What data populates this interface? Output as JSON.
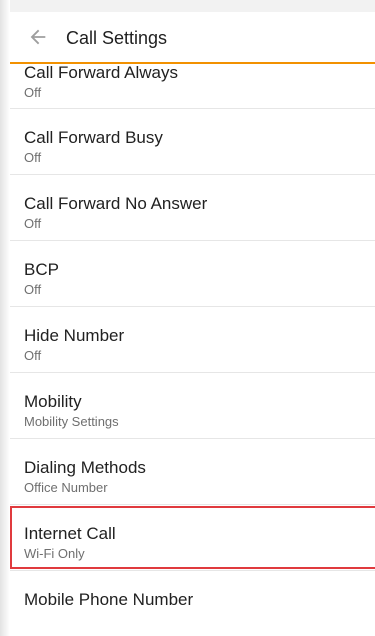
{
  "app_bar": {
    "title": "Call Settings",
    "back_icon": "arrow-back-icon",
    "accent_color": "#f29100"
  },
  "settings": [
    {
      "label": "Call Forward Always",
      "value": "Off"
    },
    {
      "label": "Call Forward Busy",
      "value": "Off"
    },
    {
      "label": "Call Forward No Answer",
      "value": "Off"
    },
    {
      "label": "BCP",
      "value": "Off"
    },
    {
      "label": "Hide Number",
      "value": "Off"
    },
    {
      "label": "Mobility",
      "value": "Mobility Settings"
    },
    {
      "label": "Dialing Methods",
      "value": "Office Number"
    },
    {
      "label": "Internet Call",
      "value": "Wi-Fi Only"
    },
    {
      "label": "Mobile Phone Number",
      "value": ""
    }
  ],
  "highlight_color": "#e03a3e"
}
